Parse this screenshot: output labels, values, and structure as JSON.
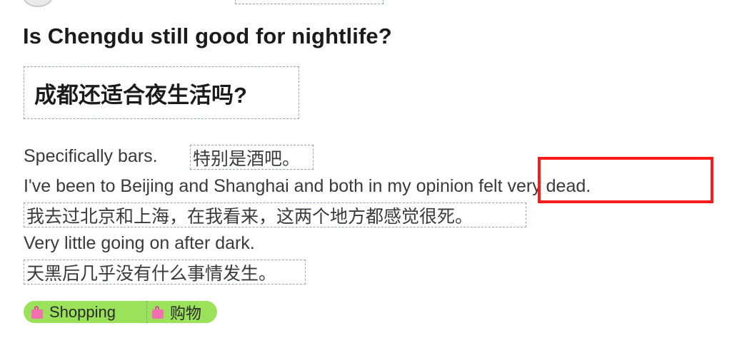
{
  "question": {
    "title_en": "Is Chengdu still good for nightlife?",
    "title_zh": "成都还适合夜生活吗?"
  },
  "body": {
    "line1_en": "Specifically bars.",
    "line1_zh": "特别是酒吧。",
    "line2_en": "I've been to Beijing and Shanghai and both in my opinion felt very dead.",
    "line2_zh": "我去过北京和上海，在我看来，这两个地方都感觉很死。",
    "line3_en": "Very little going on after dark.",
    "line3_zh": "天黑后几乎没有什么事情发生。"
  },
  "tag": {
    "label_en": "Shopping",
    "label_zh": "购物",
    "icon": "shopping-bag-icon",
    "color": "#9be25a"
  },
  "highlight": {
    "color": "#ff1a1a"
  }
}
